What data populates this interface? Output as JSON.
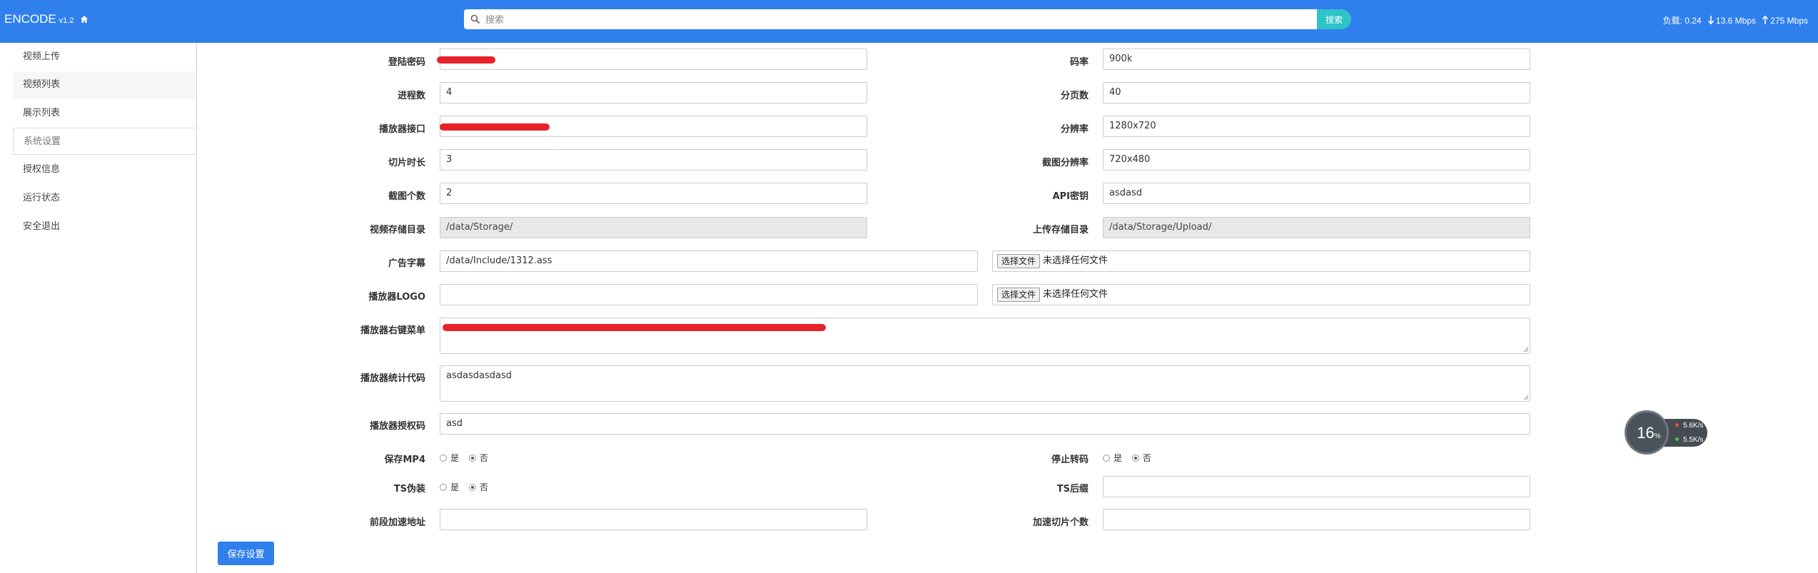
{
  "header": {
    "brand": "ENCODE",
    "version": "v1.2",
    "search_placeholder": "搜索",
    "search_button": "搜索",
    "load_label": "负载:",
    "load_value": "0.24",
    "down_speed": "13.6 Mbps",
    "up_speed": "275 Mbps"
  },
  "sidebar": {
    "items": [
      {
        "label": "视频上传"
      },
      {
        "label": "视频列表"
      },
      {
        "label": "展示列表"
      },
      {
        "label": "系统设置"
      },
      {
        "label": "授权信息"
      },
      {
        "label": "运行状态"
      },
      {
        "label": "安全退出"
      }
    ]
  },
  "form": {
    "login_password": {
      "label": "登陆密码",
      "value": ""
    },
    "bitrate": {
      "label": "码率",
      "value": "900k"
    },
    "processes": {
      "label": "进程数",
      "value": "4"
    },
    "page_size": {
      "label": "分页数",
      "value": "40"
    },
    "player_api": {
      "label": "播放器接口",
      "value": ""
    },
    "resolution": {
      "label": "分辨率",
      "value": "1280x720"
    },
    "slice_duration": {
      "label": "切片时长",
      "value": "3"
    },
    "screenshot_resolution": {
      "label": "截图分辨率",
      "value": "720x480"
    },
    "screenshot_count": {
      "label": "截图个数",
      "value": "2"
    },
    "api_key": {
      "label": "API密钥",
      "value": "asdasd"
    },
    "storage_dir": {
      "label": "视频存储目录",
      "value": "/data/Storage/"
    },
    "upload_dir": {
      "label": "上传存储目录",
      "value": "/data/Storage/Upload/"
    },
    "ad_subtitle": {
      "label": "广告字幕",
      "value": "/data/Include/1312.ass"
    },
    "player_logo": {
      "label": "播放器LOGO",
      "value": ""
    },
    "file_button": "选择文件",
    "file_none": "未选择任何文件",
    "context_menu": {
      "label": "播放器右键菜单",
      "value": ""
    },
    "stats_code": {
      "label": "播放器统计代码",
      "value": "asdasdasdasd"
    },
    "auth_code": {
      "label": "播放器授权码",
      "value": "asd"
    },
    "save_mp4": {
      "label": "保存MP4",
      "yes": "是",
      "no": "否",
      "selected": "否"
    },
    "stop_transcode": {
      "label": "停止转码",
      "yes": "是",
      "no": "否",
      "selected": "否"
    },
    "ts_disguise": {
      "label": "TS伪装",
      "yes": "是",
      "no": "否",
      "selected": "否"
    },
    "ts_suffix": {
      "label": "TS后缀",
      "value": ""
    },
    "cdn_address": {
      "label": "前段加速地址",
      "value": ""
    },
    "cdn_slices": {
      "label": "加速切片个数",
      "value": ""
    },
    "save_button": "保存设置"
  },
  "widget": {
    "percent": "16",
    "percent_unit": "%",
    "up": "5.6",
    "down": "5.5",
    "unit": "K/s"
  },
  "colors": {
    "header_bg": "#2f80ed",
    "search_button_bg": "#2ec3c7",
    "redaction": "#e8222a"
  }
}
